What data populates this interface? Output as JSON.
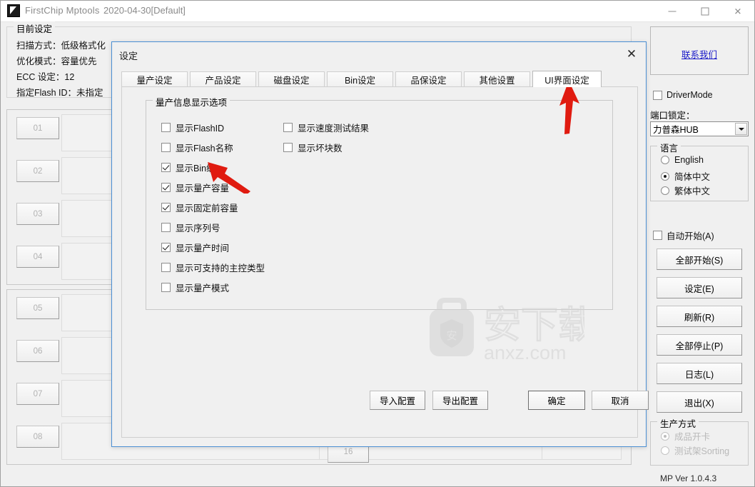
{
  "window": {
    "title": "FirstChip Mptools",
    "date": "2020-04-30[Default]",
    "icon": "app-flag-icon",
    "minimize": "minimize-icon",
    "maximize": "maximize-icon",
    "close": "close-icon"
  },
  "current_settings": {
    "group_title": "目前设定",
    "lines": [
      "扫描方式：低级格式化",
      "优化模式：容量优先",
      "ECC 设定：12",
      "指定Flash ID：未指定"
    ]
  },
  "ports": {
    "group_a": [
      "01",
      "02",
      "03",
      "04"
    ],
    "group_b": [
      "05",
      "06",
      "07",
      "08"
    ],
    "partial_bottom": "16"
  },
  "sidebar": {
    "contact_link": "联系我们",
    "driver_mode": {
      "label": "DriverMode",
      "checked": false
    },
    "port_lock_label": "端口锁定：",
    "port_lock_value": "力普森HUB",
    "language": {
      "group_title": "语言",
      "options": [
        {
          "label": "English",
          "selected": false
        },
        {
          "label": "简体中文",
          "selected": true
        },
        {
          "label": "繁体中文",
          "selected": false
        }
      ]
    },
    "auto_start": {
      "label": "自动开始(A)",
      "checked": false
    },
    "buttons": [
      "全部开始(S)",
      "设定(E)",
      "刷新(R)",
      "全部停止(P)",
      "日志(L)",
      "退出(X)"
    ],
    "production": {
      "group_title": "生产方式",
      "options": [
        {
          "label": "成品开卡",
          "selected": true,
          "disabled": true
        },
        {
          "label": "测试架Sorting",
          "selected": false,
          "disabled": true
        }
      ]
    },
    "version": "MP Ver 1.0.4.3"
  },
  "dialog": {
    "title": "设定",
    "close_icon": "close-icon",
    "tabs": [
      {
        "label": "量产设定",
        "selected": false
      },
      {
        "label": "产品设定",
        "selected": false
      },
      {
        "label": "磁盘设定",
        "selected": false
      },
      {
        "label": "Bin设定",
        "selected": false
      },
      {
        "label": "品保设定",
        "selected": false
      },
      {
        "label": "其他设置",
        "selected": false
      },
      {
        "label": "UI界面设定",
        "selected": true
      }
    ],
    "group_title": "量产信息显示选项",
    "options_left": [
      {
        "label": "显示FlashID",
        "checked": false
      },
      {
        "label": "显示Flash名称",
        "checked": false
      },
      {
        "label": "显示Bin级",
        "checked": true
      },
      {
        "label": "显示量产容量",
        "checked": true
      },
      {
        "label": "显示固定前容量",
        "checked": true
      },
      {
        "label": "显示序列号",
        "checked": false
      },
      {
        "label": "显示量产时间",
        "checked": true
      },
      {
        "label": "显示可支持的主控类型",
        "checked": false
      },
      {
        "label": "显示量产模式",
        "checked": false
      }
    ],
    "options_right": [
      {
        "label": "显示速度测试结果",
        "checked": false
      },
      {
        "label": "显示坏块数",
        "checked": false
      }
    ],
    "buttons": {
      "import": "导入配置",
      "export": "导出配置",
      "ok": "确定",
      "cancel": "取消"
    }
  },
  "watermark": {
    "text_cn": "安下载",
    "text_en": "anxz.com"
  },
  "annotations": {
    "arrow_tab": "red-arrow-pointing-to-ui-tab",
    "arrow_checkbox": "red-arrow-pointing-to-bin-checkbox"
  },
  "colors": {
    "accent_blue": "#4b8fd4",
    "link": "#1818c8",
    "arrow_red": "#e01b10",
    "bg": "#f0f0f0"
  }
}
